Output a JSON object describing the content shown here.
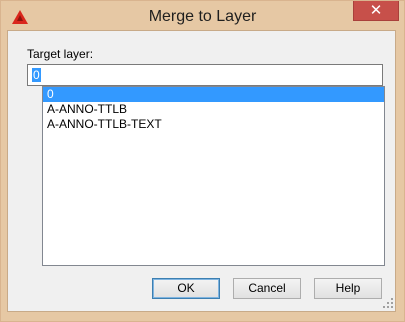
{
  "window": {
    "title": "Merge to Layer",
    "app_icon": "autocad-logo-icon",
    "close_symbol": "✕"
  },
  "form": {
    "target_label": "Target layer:",
    "target_value": "0"
  },
  "layers": [
    {
      "name": "0",
      "selected": true
    },
    {
      "name": "A-ANNO-TTLB",
      "selected": false
    },
    {
      "name": "A-ANNO-TTLB-TEXT",
      "selected": false
    }
  ],
  "buttons": {
    "ok": "OK",
    "cancel": "Cancel",
    "help": "Help"
  },
  "colors": {
    "frame": "#e6c8a4",
    "close": "#c7504a",
    "selection": "#3399ff"
  }
}
